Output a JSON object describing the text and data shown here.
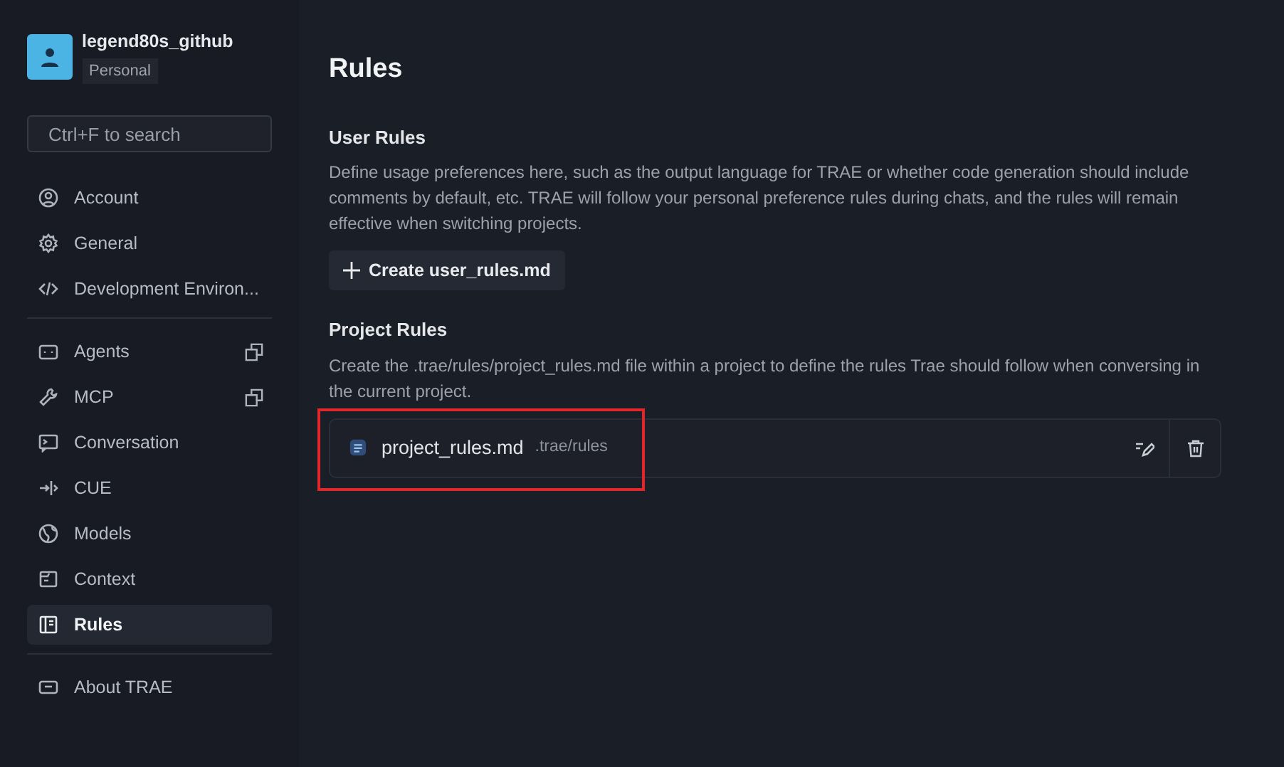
{
  "user": {
    "name": "legend80s_github",
    "plan": "Personal"
  },
  "search": {
    "placeholder": "Ctrl+F to search"
  },
  "sidebar": {
    "groups": [
      {
        "items": [
          {
            "label": "Account",
            "selected": false,
            "external": false
          },
          {
            "label": "General",
            "selected": false,
            "external": false
          },
          {
            "label": "Development Environ...",
            "selected": false,
            "external": false
          }
        ]
      },
      {
        "items": [
          {
            "label": "Agents",
            "selected": false,
            "external": true
          },
          {
            "label": "MCP",
            "selected": false,
            "external": true
          },
          {
            "label": "Conversation",
            "selected": false,
            "external": false
          },
          {
            "label": "CUE",
            "selected": false,
            "external": false
          },
          {
            "label": "Models",
            "selected": false,
            "external": false
          },
          {
            "label": "Context",
            "selected": false,
            "external": false
          },
          {
            "label": "Rules",
            "selected": true,
            "external": false
          }
        ]
      },
      {
        "items": [
          {
            "label": "About TRAE",
            "selected": false,
            "external": false
          }
        ]
      }
    ]
  },
  "page": {
    "title": "Rules",
    "user_rules": {
      "heading": "User Rules",
      "description": "Define usage preferences here, such as the output language for TRAE or whether code generation should include comments by default, etc. TRAE will follow your personal preference rules during chats, and the rules will remain effective when switching projects.",
      "button": "Create user_rules.md"
    },
    "project_rules": {
      "heading": "Project Rules",
      "description": "Create the .trae/rules/project_rules.md file within a project to define the rules Trae should follow when conversing in the current project.",
      "files": [
        {
          "name": "project_rules.md",
          "path": ".trae/rules",
          "highlighted": true
        }
      ]
    }
  }
}
